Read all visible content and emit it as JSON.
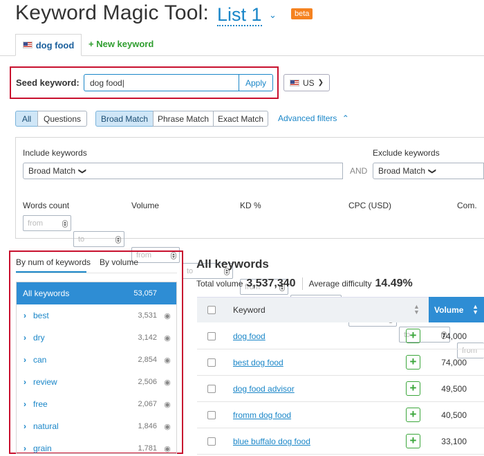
{
  "header": {
    "title": "Keyword Magic Tool:",
    "list_name": "List 1",
    "badge": "beta"
  },
  "tabs": {
    "active_label": "dog food",
    "new_label": "+ New keyword"
  },
  "seed": {
    "label": "Seed keyword:",
    "value": "dog food|",
    "apply_label": "Apply",
    "country": "US"
  },
  "filters": {
    "scope": [
      "All",
      "Questions"
    ],
    "match": [
      "Broad Match",
      "Phrase Match",
      "Exact Match"
    ],
    "advanced_label": "Advanced filters",
    "include_label": "Include keywords",
    "exclude_label": "Exclude keywords",
    "match_dropdown": "Broad Match",
    "and_label": "AND",
    "ranges": [
      "Words count",
      "Volume",
      "KD %",
      "CPC (USD)",
      "Com."
    ],
    "from_placeholder": "from",
    "to_placeholder": "to"
  },
  "groups": {
    "tab_count": "By num of keywords",
    "tab_volume": "By volume",
    "all_label": "All keywords",
    "all_count": "53,057",
    "items": [
      {
        "label": "best",
        "count": "3,531"
      },
      {
        "label": "dry",
        "count": "3,142"
      },
      {
        "label": "can",
        "count": "2,854"
      },
      {
        "label": "review",
        "count": "2,506"
      },
      {
        "label": "free",
        "count": "2,067"
      },
      {
        "label": "natural",
        "count": "1,846"
      },
      {
        "label": "grain",
        "count": "1,781"
      }
    ]
  },
  "results": {
    "title": "All keywords",
    "total_volume_label": "Total volume",
    "total_volume": "3,537,340",
    "avg_difficulty_label": "Average difficulty",
    "avg_difficulty": "14.49%",
    "col_keyword": "Keyword",
    "col_volume": "Volume",
    "rows": [
      {
        "keyword": "dog food",
        "volume": "74,000"
      },
      {
        "keyword": "best dog food",
        "volume": "74,000"
      },
      {
        "keyword": "dog food advisor",
        "volume": "49,500"
      },
      {
        "keyword": "fromm dog food",
        "volume": "40,500"
      },
      {
        "keyword": "blue buffalo dog food",
        "volume": "33,100"
      }
    ]
  }
}
